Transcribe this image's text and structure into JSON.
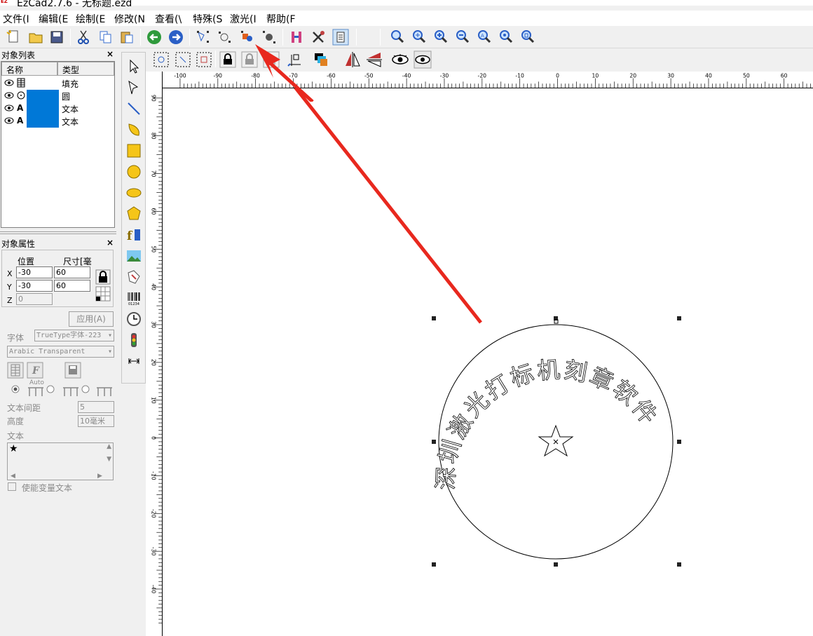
{
  "window": {
    "title": "EzCad2.7.6 - 无标题.ezd"
  },
  "menu": [
    "文件(I",
    "编辑(E",
    "绘制(E",
    "修改(N",
    "查看(\\",
    "特殊(S",
    "激光(I",
    "帮助(F"
  ],
  "object_list": {
    "title": "对象列表",
    "columns": [
      "名称",
      "类型"
    ],
    "rows": [
      {
        "kind_icon": "hatch-icon",
        "type": "填充",
        "selected": false
      },
      {
        "kind_icon": "circle-icon",
        "type": "圆",
        "selected": true
      },
      {
        "kind_icon": "text-icon",
        "glyph": "A",
        "type": "文本",
        "selected": true
      },
      {
        "kind_icon": "text-icon",
        "glyph": "A",
        "type": "文本",
        "selected": true
      }
    ]
  },
  "properties": {
    "title": "对象属性",
    "position_label": "位置",
    "size_label": "尺寸[毫",
    "x_label": "X",
    "y_label": "Y",
    "z_label": "Z",
    "x": "-30",
    "y": "-30",
    "z": "0",
    "width": "60",
    "height": "60",
    "apply_label": "应用(A)",
    "font_label": "字体",
    "font_type": "TrueType字体-223",
    "font_name": "Arabic Transparent",
    "auto_label": "Auto",
    "text_spacing_label": "文本间距",
    "text_spacing": "5",
    "height_label": "高度",
    "height_value": "10毫米",
    "text_label": "文本",
    "text_value": "★",
    "variable_text_label": "使能变量文本"
  },
  "ruler": {
    "h_ticks": [
      "-100",
      "-90",
      "-80",
      "-70",
      "-60",
      "-50",
      "-40",
      "-30",
      "-20",
      "-10",
      "0",
      "10",
      "20",
      "30",
      "40",
      "50",
      "60"
    ],
    "v_ticks": [
      "90",
      "80",
      "70",
      "60",
      "50",
      "40",
      "30",
      "20",
      "10",
      "0",
      "-10",
      "-20",
      "-30",
      "-40"
    ]
  },
  "canvas": {
    "arc_text": "深圳激光打标机刻章软件",
    "center_glyph": "★"
  },
  "colors": {
    "accent": "#0078d7",
    "arrow": "#e8281e",
    "panel_bg": "#f0f0f0"
  }
}
